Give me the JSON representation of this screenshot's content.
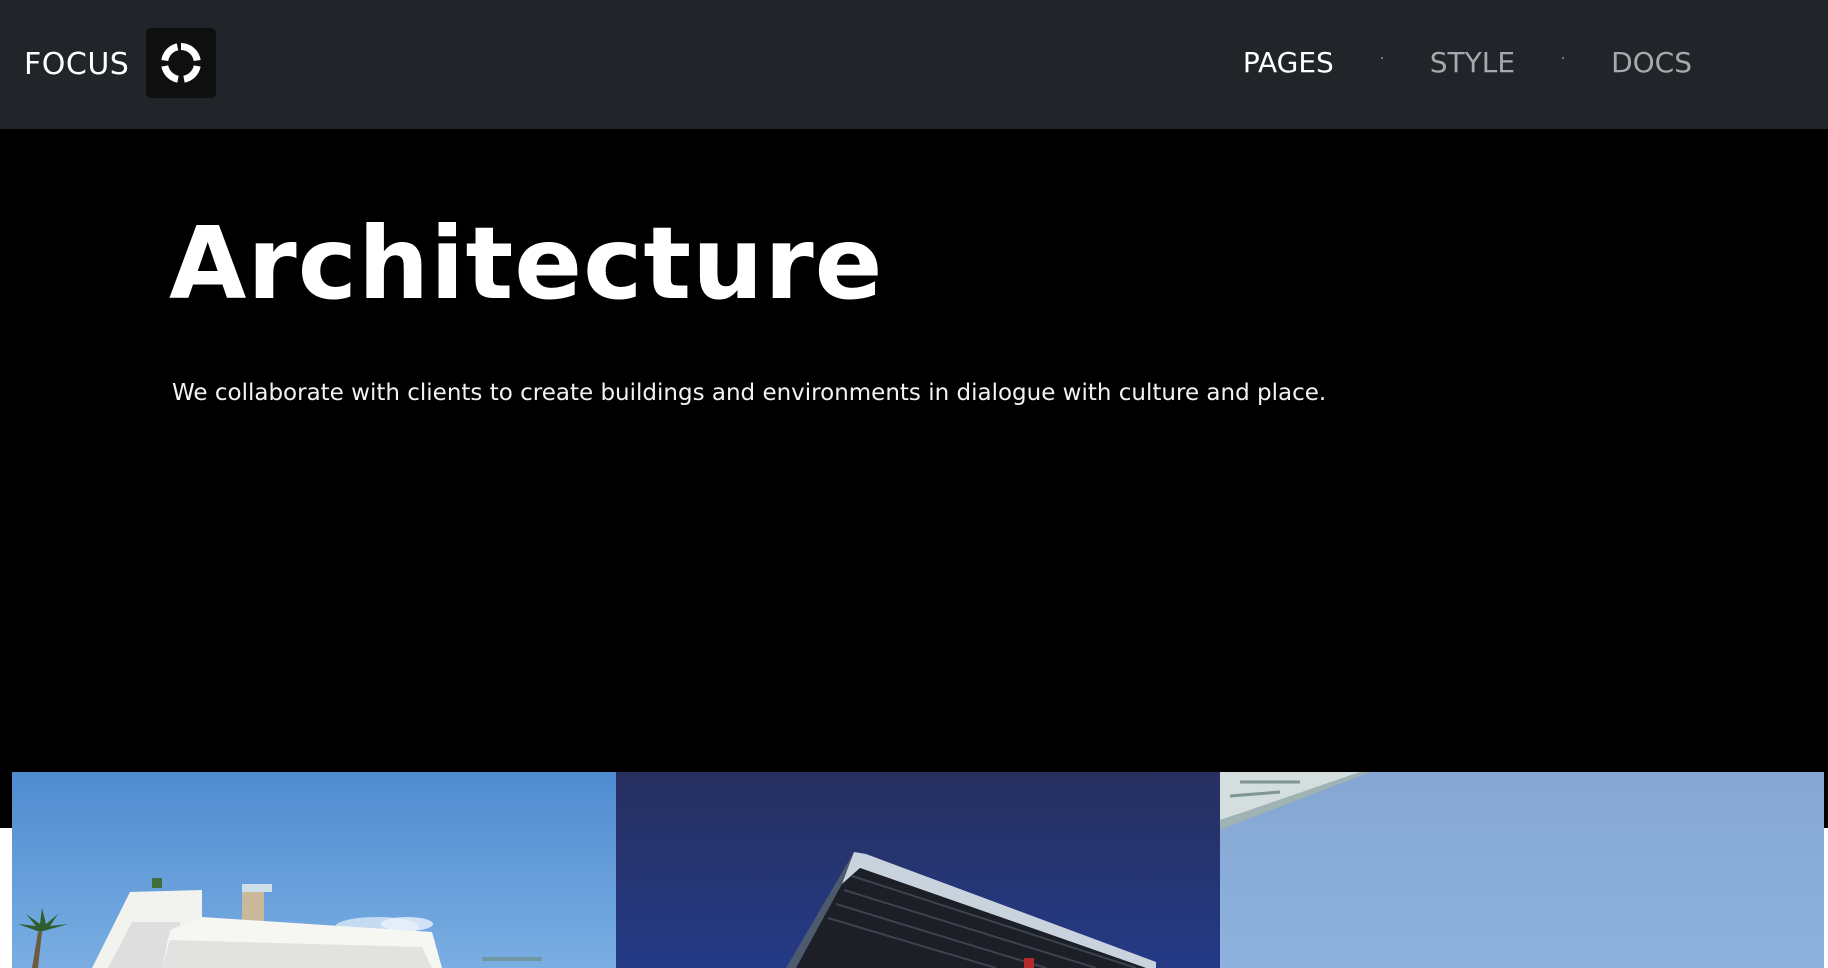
{
  "brand": {
    "name": "FOCUS",
    "logo_icon": "circle-segments-icon"
  },
  "nav": {
    "items": [
      {
        "label": "PAGES",
        "active": true
      },
      {
        "label": "STYLE",
        "active": false
      },
      {
        "label": "DOCS",
        "active": false
      }
    ]
  },
  "hero": {
    "title": "Architecture",
    "lead": "We collaborate with clients to create buildings and environments in dialogue with culture and place."
  },
  "gallery": {
    "images": [
      {
        "subject": "white-modern-building-with-palms-photo"
      },
      {
        "subject": "glass-cantilever-building-at-dusk-photo"
      },
      {
        "subject": "concrete-canopy-against-sky-photo"
      }
    ]
  },
  "colors": {
    "navbar_bg": "#212529",
    "hero_bg": "#000000",
    "text_primary": "#ffffff",
    "nav_inactive": "#a6a9ad"
  }
}
